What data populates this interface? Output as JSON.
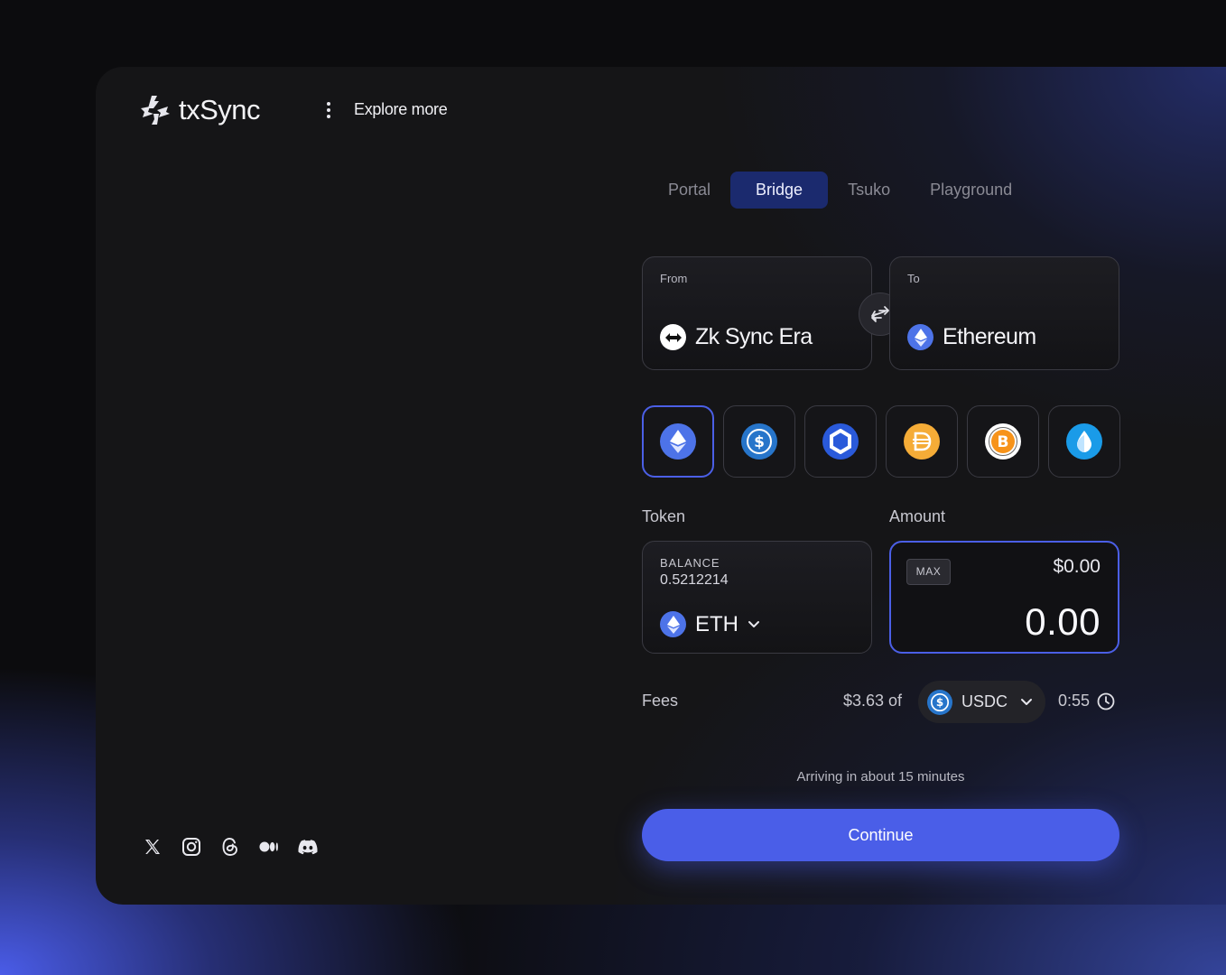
{
  "brand": {
    "name": "txSync"
  },
  "header": {
    "explore_label": "Explore more"
  },
  "tabs": [
    {
      "label": "Portal",
      "active": false
    },
    {
      "label": "Bridge",
      "active": true
    },
    {
      "label": "Tsuko",
      "active": false
    },
    {
      "label": "Playground",
      "active": false
    }
  ],
  "bridge": {
    "from": {
      "label": "From",
      "chain": "Zk Sync Era",
      "icon": "zksync-icon"
    },
    "to": {
      "label": "To",
      "chain": "Ethereum",
      "icon": "ethereum-icon"
    }
  },
  "token_options": [
    {
      "icon": "ethereum-icon",
      "selected": true
    },
    {
      "icon": "usdc-icon",
      "selected": false
    },
    {
      "icon": "chainlink-icon",
      "selected": false
    },
    {
      "icon": "dai-icon",
      "selected": false
    },
    {
      "icon": "bitcoin-icon",
      "selected": false
    },
    {
      "icon": "blue-drop-token-icon",
      "selected": false
    }
  ],
  "token": {
    "section_label": "Token",
    "balance_label": "BALANCE",
    "balance_value": "0.5212214",
    "symbol": "ETH"
  },
  "amount": {
    "section_label": "Amount",
    "max_label": "MAX",
    "usd_value": "$0.00",
    "value": "0.00"
  },
  "fees": {
    "label": "Fees",
    "amount": "$3.63 of",
    "currency": "USDC",
    "time": "0:55"
  },
  "arriving_text": "Arriving in about 15 minutes",
  "continue_label": "Continue",
  "socials": [
    "x-icon",
    "instagram-icon",
    "threads-icon",
    "medium-icon",
    "discord-icon"
  ],
  "colors": {
    "accent": "#4a5ee8",
    "active_tab_bg": "#1b2a6e",
    "background": "#151517"
  }
}
